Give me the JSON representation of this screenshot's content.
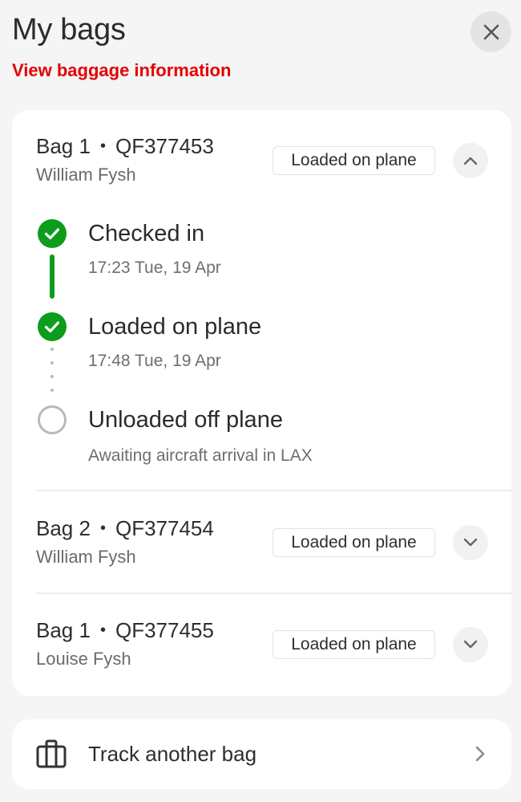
{
  "header": {
    "title": "My bags",
    "info_link": "View baggage information",
    "close_icon": "close-icon"
  },
  "colors": {
    "accent_red": "#e40000",
    "success_green": "#0c9d1c",
    "pending_gray": "#b9b9b9",
    "background": "#f5f5f5"
  },
  "bags": [
    {
      "label": "Bag 1",
      "separator": "•",
      "tag": "QF377453",
      "owner": "William Fysh",
      "status": "Loaded on plane",
      "expanded": true,
      "toggle_icon": "chevron-up-icon",
      "timeline": [
        {
          "title": "Checked in",
          "subtitle": "17:23 Tue, 19 Apr",
          "state": "done",
          "icon": "check-circle-icon"
        },
        {
          "title": "Loaded on plane",
          "subtitle": "17:48 Tue, 19 Apr",
          "state": "done",
          "icon": "check-circle-icon"
        },
        {
          "title": "Unloaded off plane",
          "subtitle": "Awaiting aircraft arrival in LAX",
          "state": "pending",
          "icon": "empty-circle-icon"
        }
      ]
    },
    {
      "label": "Bag 2",
      "separator": "•",
      "tag": "QF377454",
      "owner": "William Fysh",
      "status": "Loaded on plane",
      "expanded": false,
      "toggle_icon": "chevron-down-icon"
    },
    {
      "label": "Bag 1",
      "separator": "•",
      "tag": "QF377455",
      "owner": "Louise Fysh",
      "status": "Loaded on plane",
      "expanded": false,
      "toggle_icon": "chevron-down-icon"
    }
  ],
  "track_another": {
    "label": "Track another bag",
    "icon": "suitcase-icon",
    "chevron": "chevron-right-icon"
  }
}
